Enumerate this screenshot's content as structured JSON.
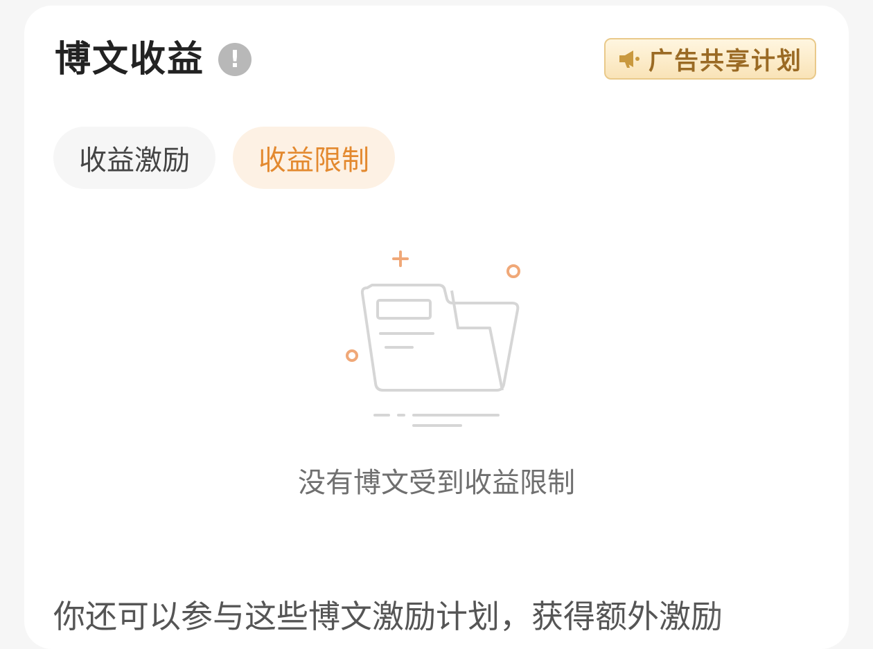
{
  "header": {
    "title": "博文收益",
    "info_icon": "exclamation-circle-icon",
    "ad_button_label": "广告共享计划",
    "ad_button_icon": "megaphone-icon"
  },
  "tabs": [
    {
      "label": "收益激励",
      "active": false
    },
    {
      "label": "收益限制",
      "active": true
    }
  ],
  "empty_state": {
    "icon": "empty-folder-icon",
    "message": "没有博文受到收益限制"
  },
  "promo": {
    "text": "你还可以参与这些博文激励计划，获得额外激励"
  },
  "colors": {
    "accent": "#e3892f",
    "active_tab_bg": "#fdf1e4",
    "ad_gold": "#9a6a24",
    "illustration_dots": "#f0a878"
  }
}
